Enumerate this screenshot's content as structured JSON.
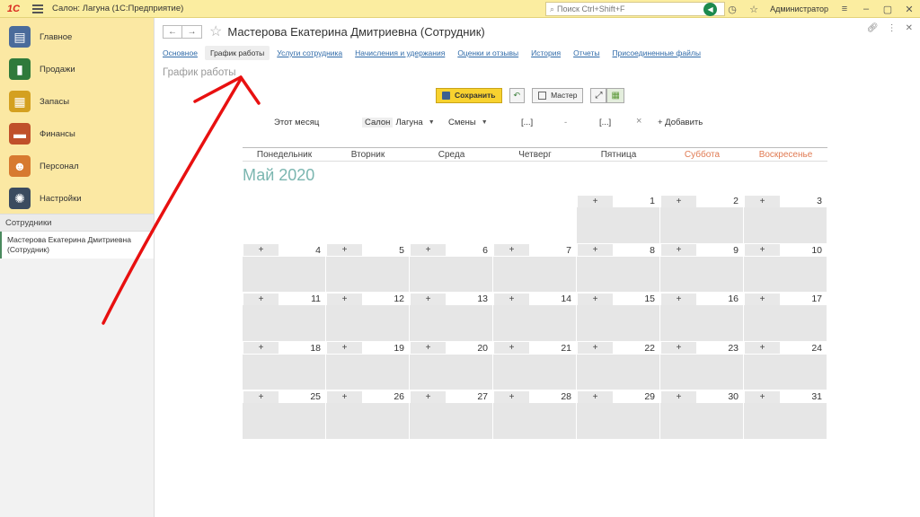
{
  "topbar": {
    "logo": "1С",
    "title": "Салон: Лагуна  (1С:Предприятие)",
    "search_placeholder": "Поиск Ctrl+Shift+F",
    "user": "Администратор"
  },
  "sidebar": {
    "items": [
      {
        "label": "Главное",
        "icon": "clipboard-icon",
        "color": "#4a6b9b"
      },
      {
        "label": "Продажи",
        "icon": "chart-icon",
        "color": "#2f7a3b"
      },
      {
        "label": "Запасы",
        "icon": "boxes-icon",
        "color": "#d4a020"
      },
      {
        "label": "Финансы",
        "icon": "wallet-icon",
        "color": "#c0502a"
      },
      {
        "label": "Персонал",
        "icon": "people-icon",
        "color": "#d77a30"
      },
      {
        "label": "Настройки",
        "icon": "gear-icon",
        "color": "#3b4b5f"
      }
    ],
    "section_header": "Сотрудники",
    "open_item": "Мастерова Екатерина Дмитриевна (Сотрудник)"
  },
  "doc": {
    "title": "Мастерова Екатерина Дмитриевна (Сотрудник)"
  },
  "tabs": [
    {
      "label": "Основное",
      "active": false
    },
    {
      "label": "График работы",
      "active": true
    },
    {
      "label": "Услуги сотрудника",
      "active": false
    },
    {
      "label": "Начисления и удержания",
      "active": false
    },
    {
      "label": "Оценки и отзывы",
      "active": false
    },
    {
      "label": "История",
      "active": false
    },
    {
      "label": "Отчеты",
      "active": false
    },
    {
      "label": "Присоединенные файлы",
      "active": false
    }
  ],
  "section_title": "График работы",
  "commands": {
    "save": "Сохранить",
    "master": "Мастер"
  },
  "filters": {
    "period": "Этот месяц",
    "salon_label": "Салон",
    "salon_value": "Лагуна",
    "shifts": "Смены",
    "date_from": "[...]",
    "dash": "-",
    "date_to": "[...]",
    "clear": "×",
    "add": "+ Добавить"
  },
  "calendar": {
    "weekdays": [
      "Понедельник",
      "Вторник",
      "Среда",
      "Четверг",
      "Пятница",
      "Суббота",
      "Воскресенье"
    ],
    "month": "Май 2020",
    "first_weekday_index": 4,
    "days_in_month": 31,
    "plus": "+"
  },
  "colors": {
    "accent": "#fbeda0",
    "weekend": "#e07a52",
    "month_title": "#7bb6b0",
    "annotation": "#e81010"
  }
}
